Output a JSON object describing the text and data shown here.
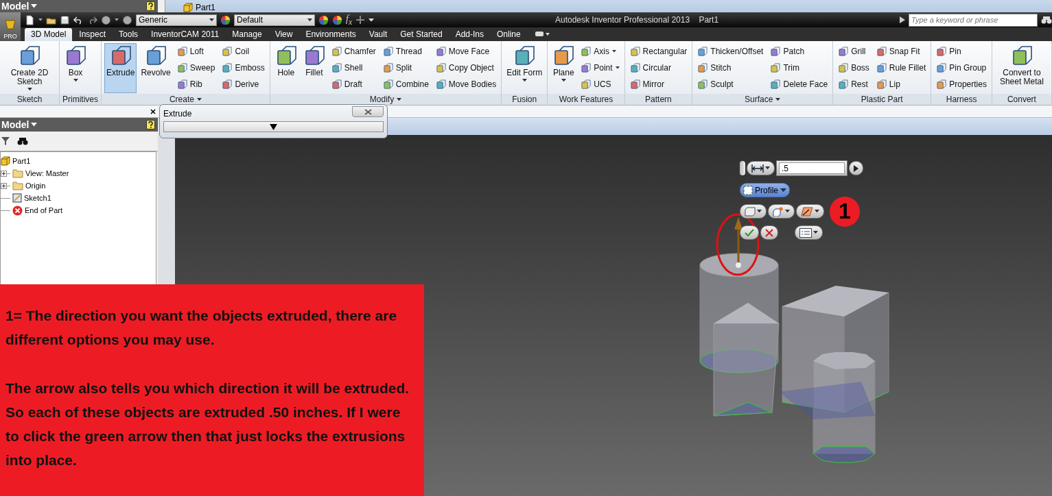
{
  "browser_header": {
    "title": "Model"
  },
  "document_tab": {
    "label": "Part1"
  },
  "app_button": {
    "label": "PRO"
  },
  "quick_access": {
    "material": "Generic",
    "appearance": "Default",
    "formula": "f$_{x}$"
  },
  "title_bar": {
    "title": "Autodesk Inventor Professional 2013",
    "document": "Part1"
  },
  "search": {
    "placeholder": "Type a keyword or phrase"
  },
  "tabs": [
    {
      "label": "3D Model",
      "selected": true
    },
    {
      "label": "Inspect",
      "selected": false
    },
    {
      "label": "Tools",
      "selected": false
    },
    {
      "label": "InventorCAM 2011",
      "selected": false
    },
    {
      "label": "Manage",
      "selected": false
    },
    {
      "label": "View",
      "selected": false
    },
    {
      "label": "Environments",
      "selected": false
    },
    {
      "label": "Vault",
      "selected": false
    },
    {
      "label": "Get Started",
      "selected": false
    },
    {
      "label": "Add-Ins",
      "selected": false
    },
    {
      "label": "Online",
      "selected": false
    }
  ],
  "ribbon_panels": [
    {
      "title": "Sketch",
      "expandable": false,
      "tools": [
        {
          "label": "Create 2D Sketch",
          "kind": "large",
          "dropdown": true,
          "selected": false
        }
      ]
    },
    {
      "title": "Primitives",
      "expandable": false,
      "tools": [
        {
          "label": "Box",
          "kind": "large",
          "dropdown": true,
          "selected": false
        }
      ]
    },
    {
      "title": "Create",
      "expandable": true,
      "tools": [
        {
          "label": "Extrude",
          "kind": "large",
          "dropdown": false,
          "selected": true
        },
        {
          "label": "Revolve",
          "kind": "large",
          "dropdown": false,
          "selected": false
        },
        {
          "label": "Loft",
          "kind": "small",
          "dropdown": false,
          "selected": false
        },
        {
          "label": "Sweep",
          "kind": "small",
          "dropdown": false,
          "selected": false
        },
        {
          "label": "Rib",
          "kind": "small",
          "dropdown": false,
          "selected": false
        },
        {
          "label": "Coil",
          "kind": "small",
          "dropdown": false,
          "selected": false
        },
        {
          "label": "Emboss",
          "kind": "small",
          "dropdown": false,
          "selected": false
        },
        {
          "label": "Derive",
          "kind": "small",
          "dropdown": false,
          "selected": false
        }
      ]
    },
    {
      "title": "Modify",
      "expandable": true,
      "tools": [
        {
          "label": "Hole",
          "kind": "large",
          "dropdown": false,
          "selected": false
        },
        {
          "label": "Fillet",
          "kind": "large",
          "dropdown": false,
          "selected": false
        },
        {
          "label": "Chamfer",
          "kind": "small",
          "dropdown": false,
          "selected": false
        },
        {
          "label": "Shell",
          "kind": "small",
          "dropdown": false,
          "selected": false
        },
        {
          "label": "Draft",
          "kind": "small",
          "dropdown": false,
          "selected": false
        },
        {
          "label": "Thread",
          "kind": "small",
          "dropdown": false,
          "selected": false
        },
        {
          "label": "Split",
          "kind": "small",
          "dropdown": false,
          "selected": false
        },
        {
          "label": "Combine",
          "kind": "small",
          "dropdown": false,
          "selected": false
        },
        {
          "label": "Move Face",
          "kind": "small",
          "dropdown": false,
          "selected": false
        },
        {
          "label": "Copy Object",
          "kind": "small",
          "dropdown": false,
          "selected": false
        },
        {
          "label": "Move Bodies",
          "kind": "small",
          "dropdown": false,
          "selected": false
        }
      ]
    },
    {
      "title": "Fusion",
      "expandable": false,
      "tools": [
        {
          "label": "Edit Form",
          "kind": "large",
          "dropdown": true,
          "selected": false
        }
      ]
    },
    {
      "title": "Work Features",
      "expandable": false,
      "tools": [
        {
          "label": "Plane",
          "kind": "large",
          "dropdown": true,
          "selected": false
        },
        {
          "label": "Axis",
          "kind": "small",
          "dropdown": true,
          "selected": false
        },
        {
          "label": "Point",
          "kind": "small",
          "dropdown": true,
          "selected": false
        },
        {
          "label": "UCS",
          "kind": "small",
          "dropdown": false,
          "selected": false
        }
      ]
    },
    {
      "title": "Pattern",
      "expandable": false,
      "tools": [
        {
          "label": "Rectangular",
          "kind": "small",
          "dropdown": false,
          "selected": false
        },
        {
          "label": "Circular",
          "kind": "small",
          "dropdown": false,
          "selected": false
        },
        {
          "label": "Mirror",
          "kind": "small",
          "dropdown": false,
          "selected": false
        }
      ]
    },
    {
      "title": "Surface",
      "expandable": true,
      "tools": [
        {
          "label": "Thicken/Offset",
          "kind": "small",
          "dropdown": false,
          "selected": false
        },
        {
          "label": "Stitch",
          "kind": "small",
          "dropdown": false,
          "selected": false
        },
        {
          "label": "Sculpt",
          "kind": "small",
          "dropdown": false,
          "selected": false
        },
        {
          "label": "Patch",
          "kind": "small",
          "dropdown": false,
          "selected": false
        },
        {
          "label": "Trim",
          "kind": "small",
          "dropdown": false,
          "selected": false
        },
        {
          "label": "Delete Face",
          "kind": "small",
          "dropdown": false,
          "selected": false
        }
      ]
    },
    {
      "title": "Plastic Part",
      "expandable": false,
      "tools": [
        {
          "label": "Grill",
          "kind": "small",
          "dropdown": false,
          "selected": false
        },
        {
          "label": "Boss",
          "kind": "small",
          "dropdown": false,
          "selected": false
        },
        {
          "label": "Rest",
          "kind": "small",
          "dropdown": false,
          "selected": false
        },
        {
          "label": "Snap Fit",
          "kind": "small",
          "dropdown": false,
          "selected": false
        },
        {
          "label": "Rule Fillet",
          "kind": "small",
          "dropdown": false,
          "selected": false
        },
        {
          "label": "Lip",
          "kind": "small",
          "dropdown": false,
          "selected": false
        }
      ]
    },
    {
      "title": "Harness",
      "expandable": false,
      "tools": [
        {
          "label": "Pin",
          "kind": "small",
          "dropdown": false,
          "selected": false
        },
        {
          "label": "Pin Group",
          "kind": "small",
          "dropdown": false,
          "selected": false
        },
        {
          "label": "Properties",
          "kind": "small",
          "dropdown": false,
          "selected": false
        }
      ]
    },
    {
      "title": "Convert",
      "expandable": false,
      "tools": [
        {
          "label": "Convert to Sheet Metal",
          "kind": "large",
          "dropdown": false,
          "selected": false
        }
      ]
    }
  ],
  "extrude_dialog": {
    "title": "Extrude"
  },
  "browser": {
    "title": "Model",
    "tree": [
      {
        "label": "Part1",
        "kind": "part",
        "children": [
          {
            "label": "View: Master",
            "kind": "branch"
          },
          {
            "label": "Origin",
            "kind": "branch"
          },
          {
            "label": "Sketch1",
            "kind": "leaf"
          },
          {
            "label": "End of Part",
            "kind": "leaf"
          }
        ]
      }
    ]
  },
  "mini_toolbar": {
    "distance": ".5",
    "profile": {
      "label": "Profile",
      "selected": true
    },
    "callout": "1"
  },
  "note": {
    "paragraphs": [
      "1= The direction you want the objects extruded, there are different options you may use.",
      "The arrow also tells you which direction it will be extruded. So each of these objects are extruded .50 inches. If I were to click the green arrow then that just locks the extrusions into place."
    ]
  }
}
